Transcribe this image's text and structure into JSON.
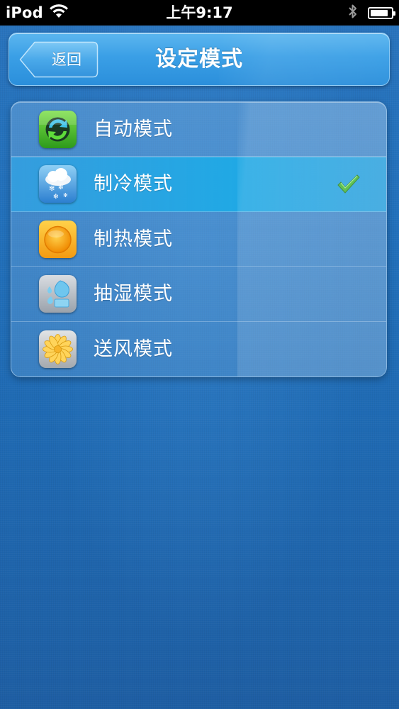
{
  "status_bar": {
    "carrier": "iPod",
    "time": "上午9:17",
    "icons": [
      "wifi-icon",
      "bluetooth-icon",
      "battery-icon"
    ],
    "battery_level": 0.85
  },
  "nav": {
    "back_label": "返回",
    "title": "设定模式"
  },
  "modes": [
    {
      "label": "自动模式",
      "icon": "auto-mode-icon",
      "selected": false
    },
    {
      "label": "制冷模式",
      "icon": "cooling-mode-icon",
      "selected": true
    },
    {
      "label": "制热模式",
      "icon": "heating-mode-icon",
      "selected": false
    },
    {
      "label": "抽湿模式",
      "icon": "dehumidify-mode-icon",
      "selected": false
    },
    {
      "label": "送风模式",
      "icon": "fan-mode-icon",
      "selected": false
    }
  ],
  "colors": {
    "background": "#2271bc",
    "nav_bar": "#3a9fe6",
    "selected_row": "#1eaae6",
    "check_mark": "#3fae3a"
  }
}
